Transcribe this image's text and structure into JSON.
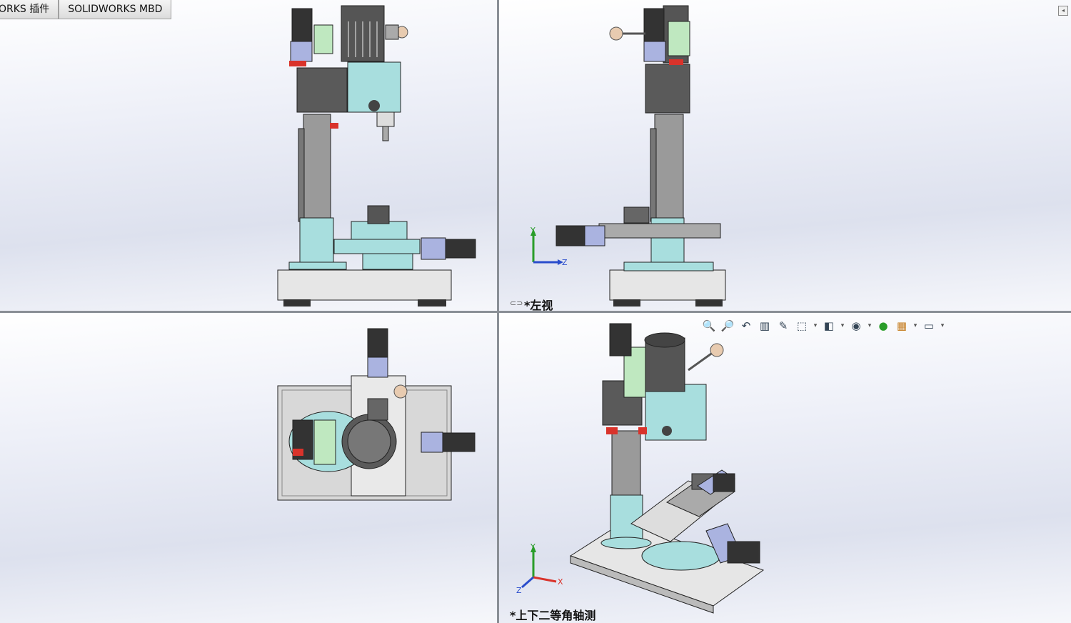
{
  "tabs": [
    {
      "label": "ORKS 插件"
    },
    {
      "label": "SOLIDWORKS MBD"
    }
  ],
  "viewports": {
    "front": {
      "label": ""
    },
    "left": {
      "label": "*左视",
      "link_icon": "link-icon"
    },
    "top": {
      "label": ""
    },
    "iso": {
      "label": "*上下二等角轴测"
    }
  },
  "triad": {
    "y": "Y",
    "z": "Z",
    "x": "X"
  },
  "hud_toolbar": [
    {
      "icon": "zoom-to-fit-icon",
      "glyph": "🔍"
    },
    {
      "icon": "zoom-to-area-icon",
      "glyph": "🔎"
    },
    {
      "icon": "previous-view-icon",
      "glyph": "↶"
    },
    {
      "icon": "section-view-icon",
      "glyph": "▥"
    },
    {
      "icon": "dynamic-annotation-icon",
      "glyph": "✎"
    },
    {
      "icon": "view-orientation-icon",
      "glyph": "⬚"
    },
    {
      "icon": "display-style-icon",
      "glyph": "◧"
    },
    {
      "icon": "hide-show-items-icon",
      "glyph": "◉"
    },
    {
      "icon": "edit-appearance-icon",
      "glyph": "●"
    },
    {
      "icon": "apply-scene-icon",
      "glyph": "▦"
    },
    {
      "icon": "view-settings-icon",
      "glyph": "▭"
    }
  ],
  "colors": {
    "cyan_part": "#a8dede",
    "dark_part": "#5a5a5a",
    "green_part": "#bfe8c0",
    "base": "#e6e6e6",
    "motor": "#333333",
    "red_part": "#d9332b"
  }
}
